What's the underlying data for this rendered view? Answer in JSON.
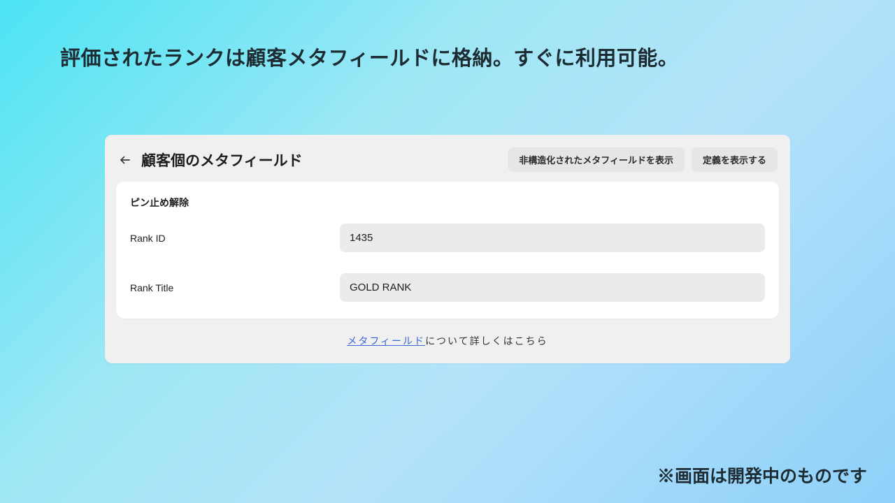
{
  "headline": "評価されたランクは顧客メタフィールドに格納。すぐに利用可能。",
  "panel": {
    "title": "顧客個のメタフィールド",
    "buttons": {
      "show_unstructured": "非構造化されたメタフィールドを表示",
      "show_definition": "定義を表示する"
    }
  },
  "card": {
    "pin_label": "ピン止め解除",
    "fields": [
      {
        "label": "Rank ID",
        "value": "1435"
      },
      {
        "label": "Rank Title",
        "value": "GOLD RANK"
      }
    ]
  },
  "footer": {
    "link_text": "メタフィールド",
    "suffix": "について詳しくはこちら"
  },
  "disclaimer": "※画面は開発中のものです"
}
